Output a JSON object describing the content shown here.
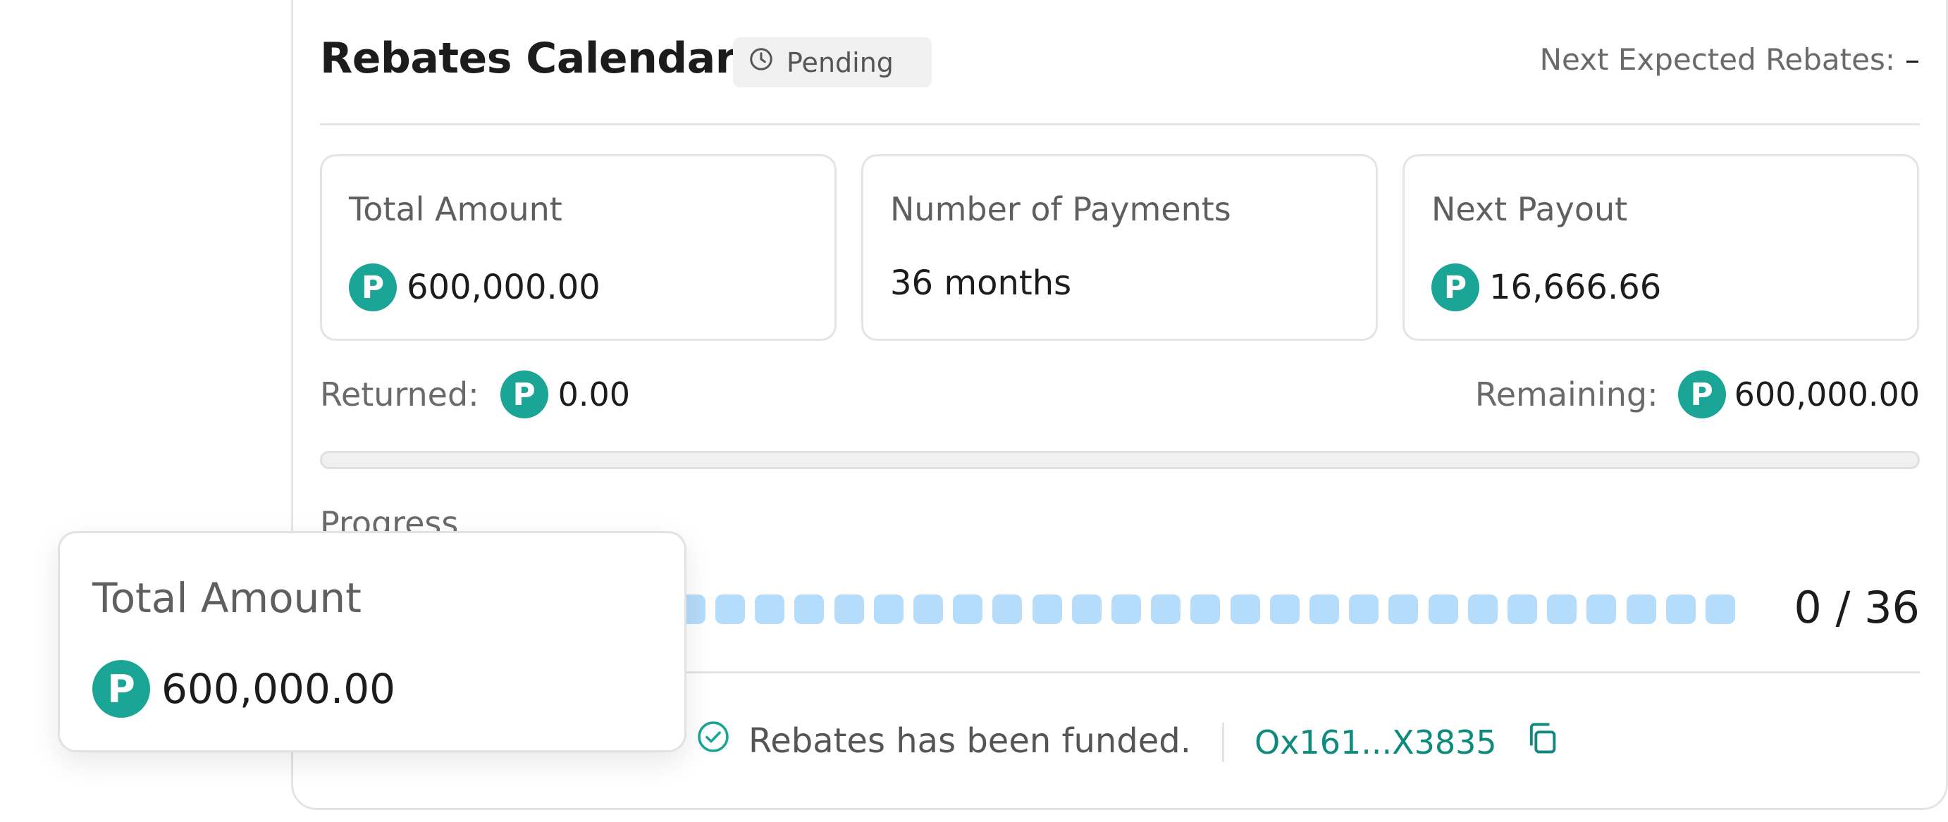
{
  "header": {
    "title": "Rebates Calendar",
    "status_badge": "Pending",
    "next_expected_label": "Next Expected Rebates:",
    "next_expected_value": "–"
  },
  "currency_icon": {
    "name": "p-coin-icon",
    "glyph": "P",
    "color": "#1aa596"
  },
  "cards": [
    {
      "label": "Total Amount",
      "value": "600,000.00",
      "has_coin": true
    },
    {
      "label": "Number of Payments",
      "value": "36 months",
      "has_coin": false
    },
    {
      "label": "Next Payout",
      "value": "16,666.66",
      "has_coin": true
    }
  ],
  "returned": {
    "label": "Returned:",
    "value": "0.00"
  },
  "remaining": {
    "label": "Remaining:",
    "value": "600,000.00"
  },
  "progress": {
    "label": "Progress",
    "fraction": 0,
    "completed_payments": 0,
    "total_payments": 36,
    "counter_text": "0 / 36",
    "dot_color": "#b5dcfb"
  },
  "funding": {
    "message": "Rebates has been funded.",
    "address": "Ox161...X3835"
  },
  "tooltip": {
    "label": "Total Amount",
    "value": "600,000.00"
  },
  "colors": {
    "accent": "#1aa596",
    "link": "#0e8a7c",
    "border": "#e4e4e4"
  }
}
